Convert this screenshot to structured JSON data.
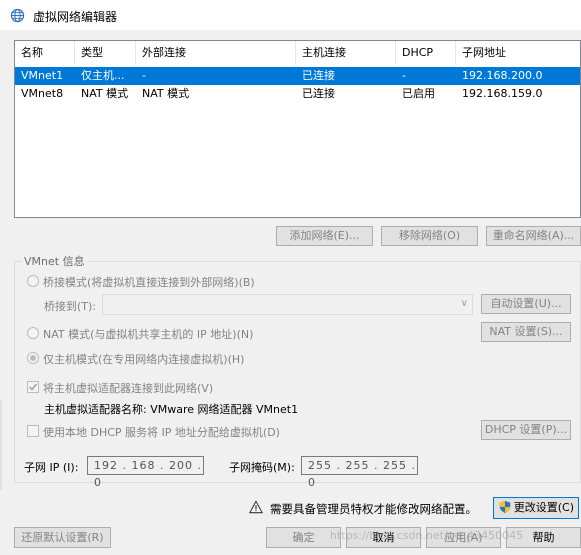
{
  "window": {
    "title": "虚拟网络编辑器"
  },
  "table": {
    "headers": [
      "名称",
      "类型",
      "外部连接",
      "主机连接",
      "DHCP",
      "子网地址"
    ],
    "rows": [
      [
        "VMnet1",
        "仅主机...",
        "-",
        "已连接",
        "-",
        "192.168.200.0"
      ],
      [
        "VMnet8",
        "NAT 模式",
        "NAT 模式",
        "已连接",
        "已启用",
        "192.168.159.0"
      ]
    ]
  },
  "list_buttons": {
    "add": "添加网络(E)...",
    "remove": "移除网络(O)",
    "rename": "重命名网络(A)..."
  },
  "vmnet_info": {
    "group_label": "VMnet 信息",
    "bridged_label": "桥接模式(将虚拟机直接连接到外部网络)(B)",
    "bridge_to_label": "桥接到(T):",
    "bridge_to_value": "",
    "auto_settings": "自动设置(U)...",
    "nat_label": "NAT 模式(与虚拟机共享主机的 IP 地址)(N)",
    "nat_settings": "NAT 设置(S)...",
    "hostonly_label": "仅主机模式(在专用网络内连接虚拟机)(H)",
    "connect_adapter_label": "将主机虚拟适配器连接到此网络(V)",
    "adapter_name_label": "主机虚拟适配器名称: VMware 网络适配器 VMnet1",
    "dhcp_label": "使用本地 DHCP 服务将 IP 地址分配给虚拟机(D)",
    "dhcp_settings": "DHCP 设置(P)...",
    "subnet_ip_label": "子网 IP (I):",
    "subnet_ip_value": "192 . 168 . 200 .  0",
    "subnet_mask_label": "子网掩码(M):",
    "subnet_mask_value": "255 . 255 . 255 .  0"
  },
  "admin": {
    "notice": "需要具备管理员特权才能修改网络配置。",
    "change_settings": "更改设置(C)"
  },
  "footer": {
    "restore": "还原默认设置(R)",
    "ok": "确定",
    "cancel": "取消",
    "apply": "应用(A)",
    "help": "帮助"
  },
  "watermark": "https://blog.csdn.net/qq_43450045"
}
